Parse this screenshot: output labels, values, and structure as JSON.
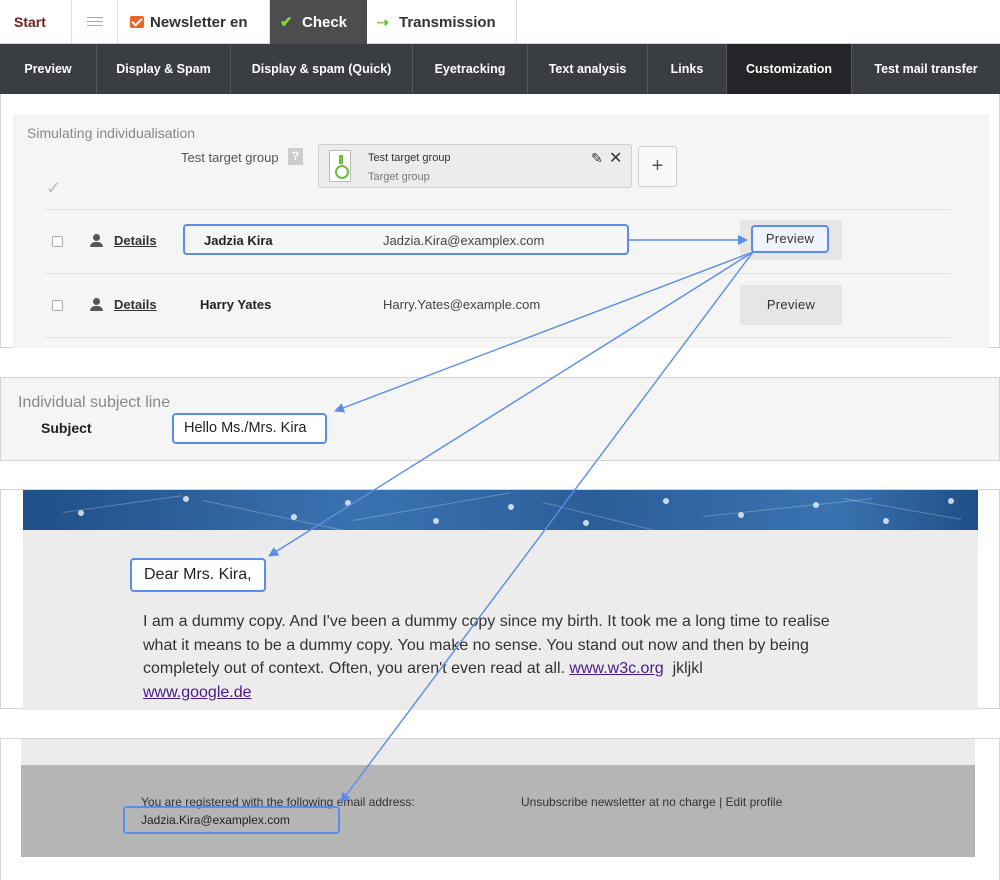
{
  "top_tabs": {
    "start": "Start",
    "newsletter": "Newsletter en",
    "check": "Check",
    "transmission": "Transmission"
  },
  "subnav": [
    {
      "label": "Preview",
      "active": false
    },
    {
      "label": "Display & Spam",
      "active": false
    },
    {
      "label": "Display & spam (Quick)",
      "active": false
    },
    {
      "label": "Eyetracking",
      "active": false
    },
    {
      "label": "Text analysis",
      "active": false
    },
    {
      "label": "Links",
      "active": false
    },
    {
      "label": "Customization",
      "active": true
    },
    {
      "label": "Test mail transfer",
      "active": false
    }
  ],
  "simulation": {
    "title": "Simulating individualisation",
    "target_group_label": "Test target group",
    "help": "?",
    "target_group": {
      "title": "Test target group",
      "subtitle": "Target group"
    },
    "add": "+",
    "rows": [
      {
        "details": "Details",
        "name": "Jadzia Kira",
        "email": "Jadzia.Kira@examplex.com",
        "preview": "Preview",
        "highlighted": true
      },
      {
        "details": "Details",
        "name": "Harry Yates",
        "email": "Harry.Yates@example.com",
        "preview": "Preview",
        "highlighted": false
      }
    ]
  },
  "subject": {
    "title": "Individual subject line",
    "label": "Subject",
    "value": "Hello Ms./Mrs. Kira"
  },
  "mail": {
    "greeting": "Dear Mrs. Kira,",
    "body": "I am a dummy copy. And I've been a dummy copy since my birth. It took me a long time to realise what it means to be a dummy copy. You make no sense. You stand out now and then by being completely out of context. Often, you aren't even read at all.",
    "link1": "www.w3c.org",
    "after_link": "jkljkl",
    "link2": "www.google.de"
  },
  "footer": {
    "registered": "You are registered with the following email address:",
    "email": "Jadzia.Kira@examplex.com",
    "unsubscribe": "Unsubscribe newsletter at no charge | Edit profile"
  },
  "colors": {
    "accent_highlight": "#5b8de8",
    "nav_bg": "#3a3d42",
    "nav_active": "#232528",
    "check_tab": "#4d4d4d",
    "link": "#4a1a8a"
  }
}
